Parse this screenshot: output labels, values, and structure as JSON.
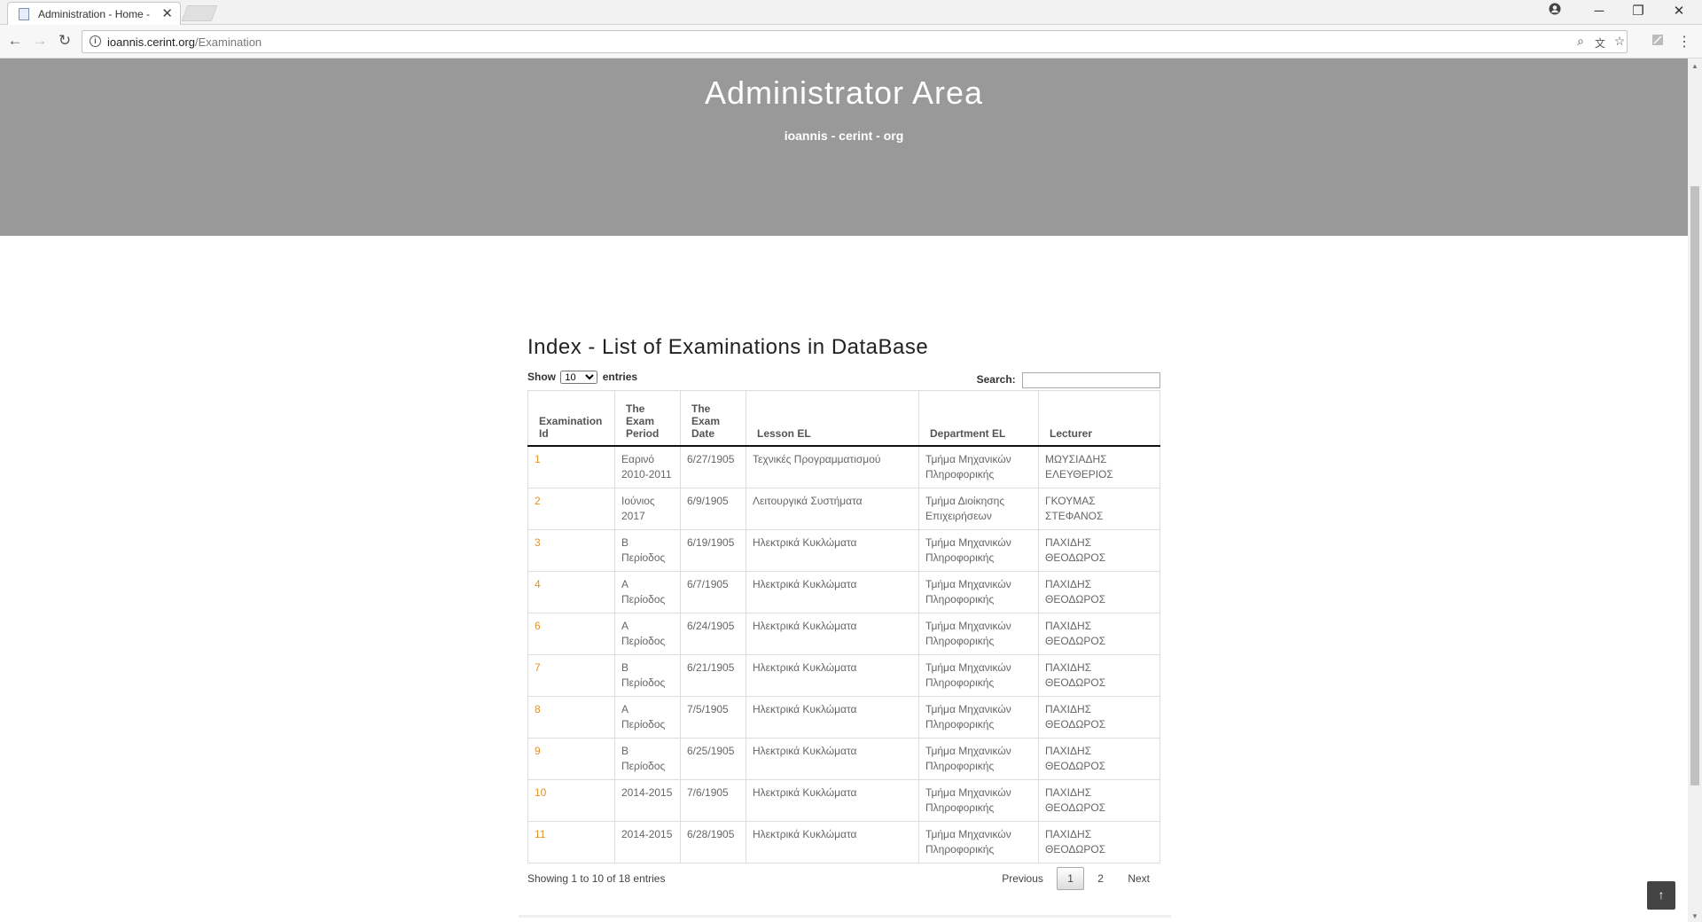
{
  "browser": {
    "tab_title": "Administration - Home -",
    "tab_close": "✕",
    "url_host": "ioannis.cerint.org",
    "url_path": "/Examination",
    "window_controls": [
      "─",
      "❐",
      "✕"
    ],
    "icons": [
      "back-icon",
      "forward-icon",
      "reload-icon",
      "zoom-icon",
      "translate-icon",
      "star-icon",
      "extension-icon",
      "menu-icon",
      "account-icon"
    ]
  },
  "hero": {
    "title": "Administrator Area",
    "subtitle": "ioannis - cerint - org"
  },
  "main": {
    "heading": "Index - List of Examinations in DataBase",
    "show_label": "Show",
    "entries_label": "entries",
    "page_length": "10",
    "search_label": "Search:",
    "search_value": "",
    "columns": [
      "Examination Id",
      "The Exam Period",
      "The Exam Date",
      "Lesson EL",
      "Department EL",
      "Lecturer"
    ],
    "rows": [
      {
        "id": "1",
        "period": "Εαρινό 2010-2011",
        "date": "6/27/1905",
        "lesson": "Τεχνικές Προγραμματισμού",
        "department": "Τμήμα Μηχανικών Πληροφορικής",
        "lecturer": "ΜΩΥΣΙΑΔΗΣ ΕΛΕΥΘΕΡΙΟΣ"
      },
      {
        "id": "2",
        "period": "Ιούνιος 2017",
        "date": "6/9/1905",
        "lesson": "Λειτουργικά Συστήματα",
        "department": "Τμήμα Διοίκησης Επιχειρήσεων",
        "lecturer": "ΓΚΟΥΜΑΣ ΣΤΕΦΑΝΟΣ"
      },
      {
        "id": "3",
        "period": "Β Περίοδος",
        "date": "6/19/1905",
        "lesson": "Ηλεκτρικά Κυκλώματα",
        "department": "Τμήμα Μηχανικών Πληροφορικής",
        "lecturer": "ΠΑΧΙΔΗΣ ΘΕΟΔΩΡΟΣ"
      },
      {
        "id": "4",
        "period": "Α Περίοδος",
        "date": "6/7/1905",
        "lesson": "Ηλεκτρικά Κυκλώματα",
        "department": "Τμήμα Μηχανικών Πληροφορικής",
        "lecturer": "ΠΑΧΙΔΗΣ ΘΕΟΔΩΡΟΣ"
      },
      {
        "id": "6",
        "period": "Α Περίοδος",
        "date": "6/24/1905",
        "lesson": "Ηλεκτρικά Κυκλώματα",
        "department": "Τμήμα Μηχανικών Πληροφορικής",
        "lecturer": "ΠΑΧΙΔΗΣ ΘΕΟΔΩΡΟΣ"
      },
      {
        "id": "7",
        "period": "Β Περίοδος",
        "date": "6/21/1905",
        "lesson": "Ηλεκτρικά Κυκλώματα",
        "department": "Τμήμα Μηχανικών Πληροφορικής",
        "lecturer": "ΠΑΧΙΔΗΣ ΘΕΟΔΩΡΟΣ"
      },
      {
        "id": "8",
        "period": "Α Περίοδος",
        "date": "7/5/1905",
        "lesson": "Ηλεκτρικά Κυκλώματα",
        "department": "Τμήμα Μηχανικών Πληροφορικής",
        "lecturer": "ΠΑΧΙΔΗΣ ΘΕΟΔΩΡΟΣ"
      },
      {
        "id": "9",
        "period": "Β Περίοδος",
        "date": "6/25/1905",
        "lesson": "Ηλεκτρικά Κυκλώματα",
        "department": "Τμήμα Μηχανικών Πληροφορικής",
        "lecturer": "ΠΑΧΙΔΗΣ ΘΕΟΔΩΡΟΣ"
      },
      {
        "id": "10",
        "period": "2014-2015",
        "date": "7/6/1905",
        "lesson": "Ηλεκτρικά Κυκλώματα",
        "department": "Τμήμα Μηχανικών Πληροφορικής",
        "lecturer": "ΠΑΧΙΔΗΣ ΘΕΟΔΩΡΟΣ"
      },
      {
        "id": "11",
        "period": "2014-2015",
        "date": "6/28/1905",
        "lesson": "Ηλεκτρικά Κυκλώματα",
        "department": "Τμήμα Μηχανικών Πληροφορικής",
        "lecturer": "ΠΑΧΙΔΗΣ ΘΕΟΔΩΡΟΣ"
      }
    ],
    "info": "Showing 1 to 10 of 18 entries",
    "pagination": {
      "previous": "Previous",
      "pages": [
        "1",
        "2"
      ],
      "current": "1",
      "next": "Next"
    }
  },
  "to_top": "↑",
  "colors": {
    "hero_bg": "#999999",
    "link": "#e0922a"
  }
}
